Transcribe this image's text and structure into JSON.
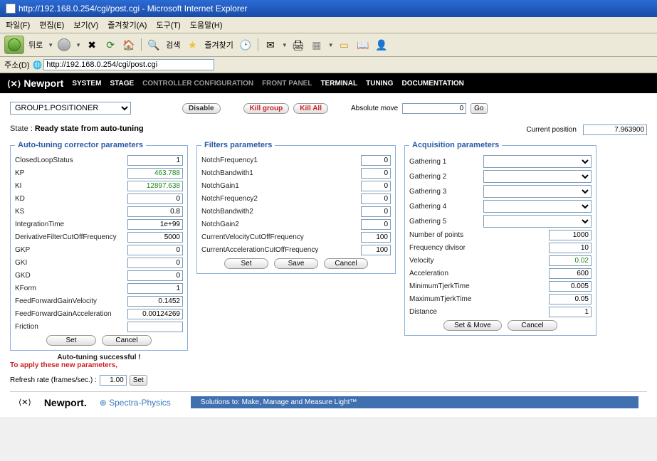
{
  "window": {
    "title": "http://192.168.0.254/cgi/post.cgi - Microsoft Internet Explorer"
  },
  "menu": {
    "file": "파일(F)",
    "edit": "편집(E)",
    "view": "보기(V)",
    "favorites": "즐겨찾기(A)",
    "tools": "도구(T)",
    "help": "도움말(H)"
  },
  "toolbar": {
    "back": "뒤로",
    "search": "검색",
    "favorites": "즐겨찾기"
  },
  "addressbar": {
    "label": "주소(D)",
    "url": "http://192.168.0.254/cgi/post.cgi"
  },
  "topnav": {
    "logo": "Newport",
    "items": [
      "SYSTEM",
      "STAGE",
      "CONTROLLER CONFIGURATION",
      "FRONT PANEL",
      "TERMINAL",
      "TUNING",
      "DOCUMENTATION"
    ]
  },
  "controls": {
    "positioner": "GROUP1.POSITIONER",
    "disable": "Disable",
    "kill_group": "Kill group",
    "kill_all": "Kill All",
    "abs_move_label": "Absolute move",
    "abs_move_value": "0",
    "go": "Go"
  },
  "state": {
    "label": "State :",
    "value": "Ready state from auto-tuning",
    "curpos_label": "Current position",
    "curpos_value": "7.963900"
  },
  "autotune": {
    "legend": "Auto-tuning corrector parameters",
    "rows": [
      {
        "label": "ClosedLoopStatus",
        "value": "1"
      },
      {
        "label": "KP",
        "value": "463.788"
      },
      {
        "label": "KI",
        "value": "12897.638"
      },
      {
        "label": "KD",
        "value": "0"
      },
      {
        "label": "KS",
        "value": "0.8"
      },
      {
        "label": "IntegrationTime",
        "value": "1e+99"
      },
      {
        "label": "DerivativeFilterCutOffFrequency",
        "value": "5000"
      },
      {
        "label": "GKP",
        "value": "0"
      },
      {
        "label": "GKI",
        "value": "0"
      },
      {
        "label": "GKD",
        "value": "0"
      },
      {
        "label": "KForm",
        "value": "1"
      },
      {
        "label": "FeedForwardGainVelocity",
        "value": "0.1452"
      },
      {
        "label": "FeedForwardGainAcceleration",
        "value": "0.00124269"
      },
      {
        "label": "Friction",
        "value": ""
      }
    ],
    "set": "Set",
    "cancel": "Cancel",
    "success": "Auto-tuning successful !",
    "apply": "To apply these new parameters,"
  },
  "filters": {
    "legend": "Filters parameters",
    "rows": [
      {
        "label": "NotchFrequency1",
        "value": "0"
      },
      {
        "label": "NotchBandwith1",
        "value": "0"
      },
      {
        "label": "NotchGain1",
        "value": "0"
      },
      {
        "label": "NotchFrequency2",
        "value": "0"
      },
      {
        "label": "NotchBandwith2",
        "value": "0"
      },
      {
        "label": "NotchGain2",
        "value": "0"
      },
      {
        "label": "CurrentVelocityCutOffFrequency",
        "value": "100"
      },
      {
        "label": "CurrentAccelerationCutOffFrequency",
        "value": "100"
      }
    ],
    "set": "Set",
    "save": "Save",
    "cancel": "Cancel"
  },
  "acquisition": {
    "legend": "Acquisition parameters",
    "gatherings": [
      "Gathering 1",
      "Gathering 2",
      "Gathering 3",
      "Gathering 4",
      "Gathering 5"
    ],
    "rows": [
      {
        "label": "Number of points",
        "value": "1000"
      },
      {
        "label": "Frequency divisor",
        "value": "10"
      },
      {
        "label": "Velocity",
        "value": "0.02"
      },
      {
        "label": "Acceleration",
        "value": "600"
      },
      {
        "label": "MinimumTjerkTime",
        "value": "0.005"
      },
      {
        "label": "MaximumTjerkTime",
        "value": "0.05"
      },
      {
        "label": "Distance",
        "value": "1"
      }
    ],
    "setmove": "Set & Move",
    "cancel": "Cancel"
  },
  "refresh": {
    "label": "Refresh rate (frames/sec.) :",
    "value": "1.00",
    "set": "Set"
  },
  "footer": {
    "newport": "Newport.",
    "spectra": "Spectra-Physics",
    "tagline": "Solutions to: Make, Manage and Measure Light™"
  }
}
